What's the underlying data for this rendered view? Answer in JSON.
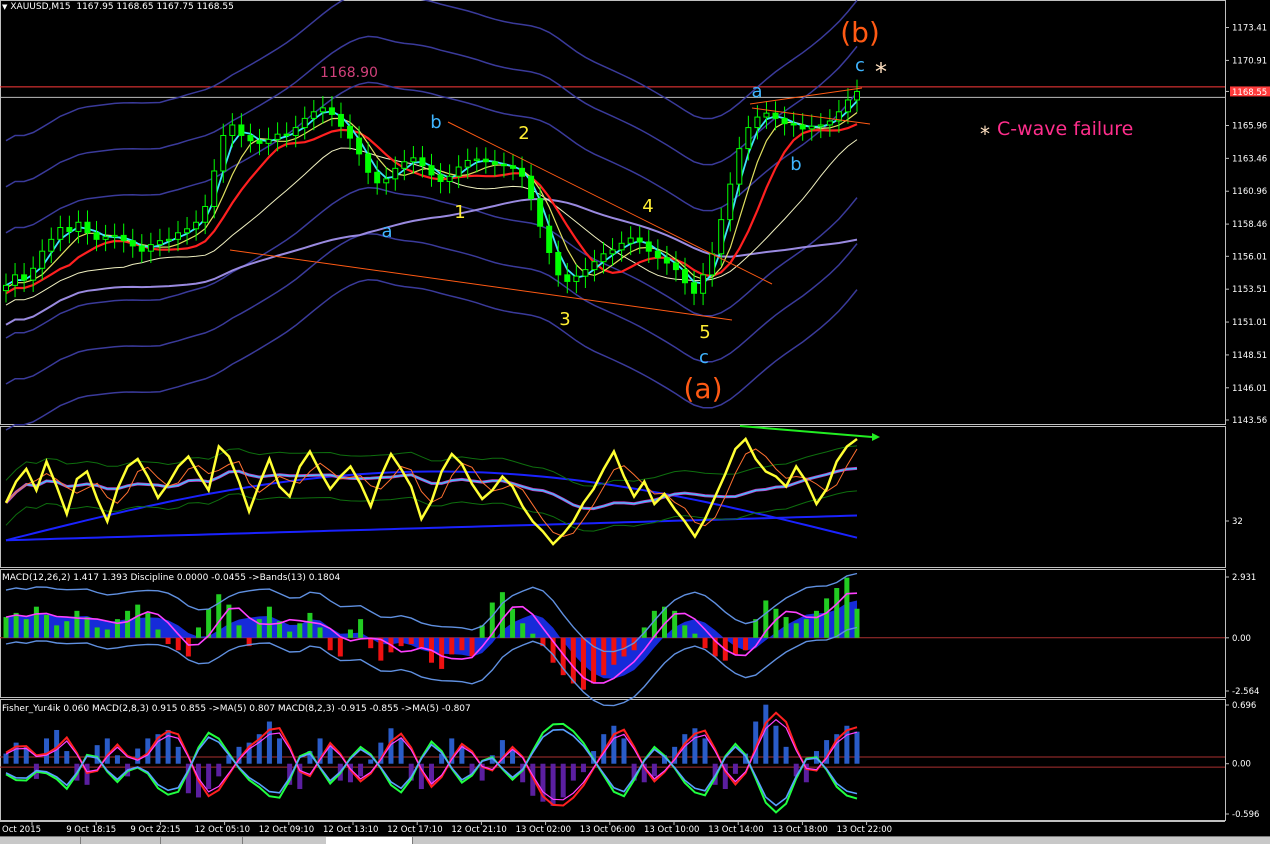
{
  "window": {
    "symbol_title": "XAUUSD,M15",
    "ohlc": "1167.95 1168.65 1167.75 1168.55",
    "last_price": "1168.55"
  },
  "colors": {
    "background": "#000000",
    "axis": "#c0c0c0",
    "candle_up": "#00ff00",
    "hline": "#ff3b3b",
    "wave_orange": "#ff5a14",
    "wave_blue": "#3fb5ff",
    "wave_yellow": "#ffee33",
    "annotation_pink": "#ff2e8c",
    "osc_yellow": "#ffff33",
    "hist_green": "#22cc22",
    "hist_red": "#ee1111",
    "hist_blue": "#1a33ff",
    "fisher_bar": "#2a5cc8",
    "fisher_neg": "#5b1fa0"
  },
  "annotations": {
    "high_label": "1168.90",
    "wave_b_big": "(b)",
    "wave_a_big": "(a)",
    "star": "*",
    "failure_text": "C-wave failure",
    "labels": [
      {
        "id": "a-left",
        "text": "a",
        "color": "blue"
      },
      {
        "id": "b-left",
        "text": "b",
        "color": "blue"
      },
      {
        "id": "c-low",
        "text": "c",
        "color": "blue"
      },
      {
        "id": "a-right",
        "text": "a",
        "color": "blue"
      },
      {
        "id": "b-right",
        "text": "b",
        "color": "blue"
      },
      {
        "id": "c-right",
        "text": "c",
        "color": "blue"
      },
      {
        "id": "w1",
        "text": "1",
        "color": "yellow"
      },
      {
        "id": "w2",
        "text": "2",
        "color": "yellow"
      },
      {
        "id": "w3",
        "text": "3",
        "color": "yellow"
      },
      {
        "id": "w4",
        "text": "4",
        "color": "yellow"
      },
      {
        "id": "w5",
        "text": "5",
        "color": "yellow"
      }
    ]
  },
  "indicators": {
    "macd_header": "MACD(12,26,2) 1.417 1.393  Discipline 0.0000 -0.0455  ->Bands(13) 0.1804",
    "fisher_header": "Fisher_Yur4ik 0.060  MACD(2,8,3) 0.915 0.855  ->MA(5) 0.807  MACD(8,2,3) -0.915 -0.855  ->MA(5) -0.807"
  },
  "chart_data": [
    {
      "type": "line",
      "panel": "price",
      "y_ticks": [
        "1173.41",
        "1170.91",
        "1168.55",
        "1165.96",
        "1163.46",
        "1160.96",
        "1158.46",
        "1156.01",
        "1153.51",
        "1151.01",
        "1148.51",
        "1146.01",
        "1143.56"
      ],
      "ylim": [
        1143.56,
        1175.2
      ],
      "hline": 1168.9,
      "x_tick_labels": [
        "Oct 2015",
        "9 Oct 18:15",
        "9 Oct 22:15",
        "12 Oct 05:10",
        "12 Oct 09:10",
        "12 Oct 13:10",
        "12 Oct 17:10",
        "12 Oct 21:10",
        "13 Oct 02:00",
        "13 Oct 06:00",
        "13 Oct 10:00",
        "13 Oct 14:00",
        "13 Oct 18:00",
        "13 Oct 22:00"
      ],
      "close": [
        1153.8,
        1154.6,
        1154.2,
        1155.1,
        1156.4,
        1157.3,
        1158.2,
        1157.9,
        1158.6,
        1157.8,
        1157.3,
        1157.5,
        1157.6,
        1157.2,
        1156.8,
        1156.4,
        1156.9,
        1157.2,
        1157.3,
        1157.8,
        1158.1,
        1158.6,
        1159.8,
        1162.5,
        1165.2,
        1166.0,
        1165.2,
        1164.8,
        1164.6,
        1164.9,
        1165.3,
        1165.2,
        1165.8,
        1166.5,
        1167.0,
        1167.3,
        1166.8,
        1165.9,
        1165.0,
        1163.8,
        1162.4,
        1161.6,
        1161.9,
        1162.7,
        1163.2,
        1163.5,
        1162.9,
        1162.2,
        1161.7,
        1162.1,
        1162.8,
        1163.3,
        1163.4,
        1163.2,
        1163.0,
        1162.9,
        1162.7,
        1162.1,
        1160.4,
        1158.3,
        1156.3,
        1154.6,
        1154.1,
        1154.5,
        1155.0,
        1155.6,
        1156.2,
        1156.5,
        1157.0,
        1157.4,
        1157.1,
        1156.4,
        1155.9,
        1155.5,
        1155.0,
        1154.0,
        1153.2,
        1154.6,
        1156.2,
        1158.8,
        1161.5,
        1164.2,
        1165.8,
        1166.6,
        1166.9,
        1166.5,
        1166.1,
        1166.0,
        1165.7,
        1165.9,
        1166.0,
        1166.3,
        1167.0,
        1167.9,
        1168.55
      ]
    },
    {
      "type": "line",
      "panel": "oscillator",
      "y_tick": "32",
      "values": [
        0.45,
        0.62,
        0.72,
        0.55,
        0.78,
        0.58,
        0.36,
        0.64,
        0.7,
        0.48,
        0.3,
        0.56,
        0.74,
        0.8,
        0.66,
        0.49,
        0.6,
        0.74,
        0.82,
        0.68,
        0.55,
        0.9,
        0.82,
        0.62,
        0.38,
        0.6,
        0.8,
        0.58,
        0.5,
        0.74,
        0.86,
        0.7,
        0.56,
        0.66,
        0.74,
        0.6,
        0.42,
        0.66,
        0.84,
        0.72,
        0.58,
        0.32,
        0.46,
        0.7,
        0.84,
        0.76,
        0.6,
        0.48,
        0.55,
        0.66,
        0.58,
        0.42,
        0.3,
        0.22,
        0.12,
        0.2,
        0.3,
        0.45,
        0.56,
        0.72,
        0.86,
        0.66,
        0.5,
        0.62,
        0.44,
        0.52,
        0.4,
        0.3,
        0.18,
        0.32,
        0.5,
        0.68,
        0.88,
        0.96,
        0.8,
        0.7,
        0.66,
        0.58,
        0.74,
        0.62,
        0.44,
        0.56,
        0.78,
        0.9,
        0.96
      ]
    },
    {
      "type": "bar",
      "panel": "macd",
      "y_ticks": [
        "2.931",
        "0.00",
        "-2.564"
      ],
      "ylim": [
        -2.564,
        2.931
      ],
      "values": [
        1.0,
        1.2,
        0.9,
        1.5,
        1.1,
        0.6,
        0.8,
        1.3,
        1.0,
        0.5,
        0.4,
        0.9,
        1.3,
        1.6,
        1.2,
        0.4,
        -0.3,
        -0.6,
        -0.9,
        0.5,
        1.4,
        2.1,
        1.6,
        0.6,
        -0.4,
        0.9,
        1.5,
        0.8,
        0.3,
        0.7,
        1.2,
        0.5,
        -0.6,
        -0.9,
        0.4,
        0.9,
        -0.5,
        -1.1,
        -0.7,
        -0.4,
        -0.3,
        -0.5,
        -1.2,
        -1.5,
        -0.8,
        -0.6,
        -0.9,
        0.6,
        1.7,
        2.2,
        1.4,
        0.7,
        0.2,
        -0.4,
        -1.2,
        -1.8,
        -2.2,
        -2.5,
        -2.2,
        -1.8,
        -1.3,
        -0.9,
        -0.6,
        0.5,
        1.3,
        1.5,
        1.3,
        0.6,
        0.2,
        -0.5,
        -0.9,
        -1.1,
        -0.8,
        -0.6,
        0.9,
        1.8,
        1.4,
        1.0,
        0.7,
        0.9,
        1.3,
        1.9,
        2.4,
        2.9,
        1.4
      ]
    },
    {
      "type": "bar",
      "panel": "fisher",
      "y_ticks": [
        "0.696",
        "0.00",
        "-0.596"
      ],
      "ylim": [
        -0.596,
        0.696
      ],
      "values": [
        0.12,
        0.25,
        0.2,
        -0.18,
        0.3,
        0.4,
        0.15,
        -0.2,
        -0.25,
        0.22,
        0.3,
        0.1,
        -0.15,
        0.18,
        0.3,
        0.35,
        0.4,
        0.2,
        -0.35,
        -0.4,
        -0.3,
        -0.15,
        0.1,
        0.2,
        0.25,
        0.35,
        0.5,
        0.3,
        -0.25,
        -0.3,
        0.15,
        0.3,
        0.22,
        -0.2,
        -0.22,
        -0.15,
        0.05,
        0.25,
        0.42,
        0.3,
        -0.2,
        -0.3,
        -0.25,
        0.12,
        0.3,
        0.22,
        -0.12,
        -0.2,
        0.1,
        0.28,
        0.16,
        -0.22,
        -0.38,
        -0.45,
        -0.5,
        -0.4,
        -0.2,
        -0.1,
        0.15,
        0.35,
        0.45,
        0.3,
        -0.2,
        -0.22,
        -0.15,
        0.1,
        0.2,
        0.35,
        0.42,
        0.3,
        -0.25,
        -0.3,
        -0.12,
        0.12,
        0.5,
        0.7,
        0.45,
        0.2,
        -0.15,
        -0.22,
        0.15,
        0.28,
        0.35,
        0.45,
        0.38
      ]
    }
  ]
}
